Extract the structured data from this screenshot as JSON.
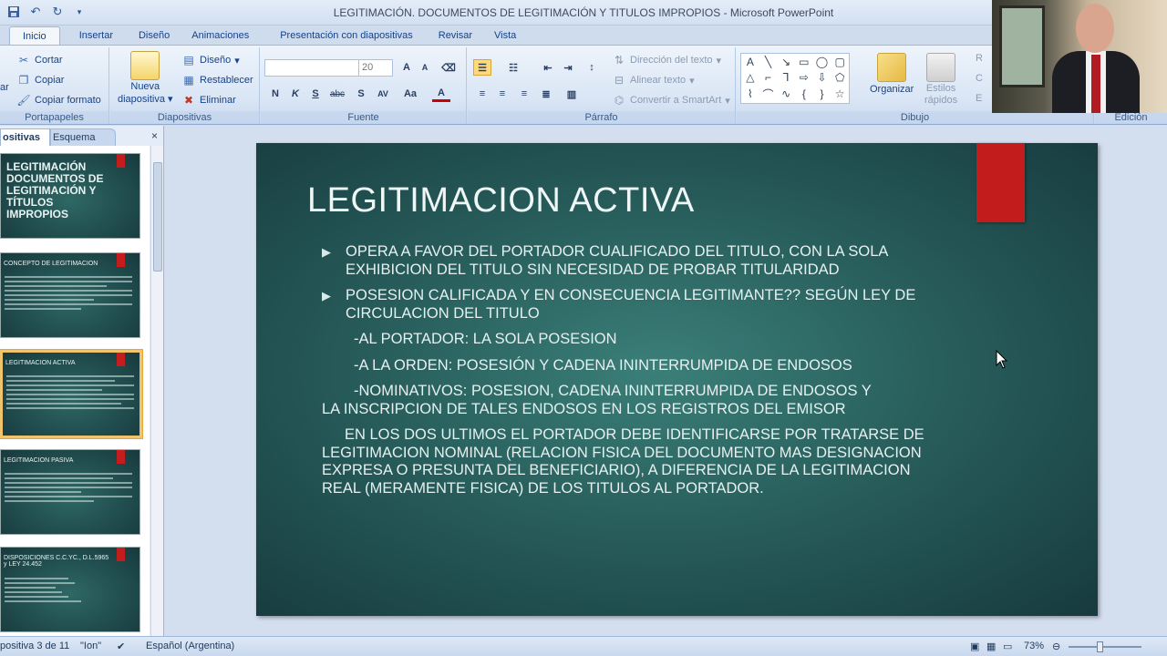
{
  "window": {
    "title": "LEGITIMACIÓN. DOCUMENTOS DE LEGITIMACIÓN Y TITULOS IMPROPIOS - Microsoft PowerPoint"
  },
  "quick_access": [
    "save-icon",
    "undo-icon",
    "redo-icon"
  ],
  "ribbon_tabs": [
    "Inicio",
    "Insertar",
    "Diseño",
    "Animaciones",
    "Presentación con diapositivas",
    "Revisar",
    "Vista"
  ],
  "ribbon": {
    "portapapeles": {
      "label": "Portapapeles",
      "cortar": "Cortar",
      "copiar": "Copiar",
      "copiar_formato": "Copiar formato",
      "pegar_partial": "ar"
    },
    "diapositivas": {
      "label": "Diapositivas",
      "nueva": "Nueva",
      "nueva2": "diapositiva",
      "diseno": "Diseño",
      "restablecer": "Restablecer",
      "eliminar": "Eliminar"
    },
    "fuente": {
      "label": "Fuente",
      "font_name": "",
      "font_size": "20",
      "bold": "N",
      "italic": "K",
      "underline": "S",
      "strike": "abc",
      "shadow": "S",
      "spacing": "AV",
      "case": "Aa",
      "color": "A"
    },
    "parrafo": {
      "label": "Párrafo",
      "direccion": "Dirección del texto",
      "alinear": "Alinear texto",
      "smartart": "Convertir a SmartArt"
    },
    "dibujo": {
      "label": "Dibujo",
      "organizar": "Organizar",
      "estilos": "Estilos",
      "estilos2": "rápidos"
    },
    "edicion": {
      "label": "Edición",
      "partial1": "R",
      "partial2": "C",
      "partial3": "E"
    }
  },
  "panel": {
    "tab_slides": "ositivas",
    "tab_outline": "Esquema",
    "close": "×"
  },
  "thumbnails": [
    {
      "title": "LEGITIMACIÓN DOCUMENTOS DE LEGITIMACIÓN Y TÍTULOS IMPROPIOS"
    },
    {
      "title": "CONCEPTO DE LEGITIMACION"
    },
    {
      "title": "LEGITIMACION ACTIVA"
    },
    {
      "title": "LEGITIMACION PASIVA"
    },
    {
      "title": "DISPOSICIONES C.C.YC., D.L.5965 y LEY 24.452"
    }
  ],
  "slide": {
    "title": "LEGITIMACION ACTIVA",
    "bullets": [
      "OPERA A FAVOR DEL PORTADOR CUALIFICADO DEL TITULO, CON LA SOLA EXHIBICION DEL TITULO SIN NECESIDAD DE PROBAR TITULARIDAD",
      "POSESION CALIFICADA Y EN CONSECUENCIA LEGITIMANTE?? SEGÚN LEY DE CIRCULACION DEL TITULO"
    ],
    "sub1": "-AL PORTADOR: LA SOLA POSESION",
    "sub2": "-A LA ORDEN: POSESIÓN Y CADENA ININTERRUMPIDA DE ENDOSOS",
    "sub3a": "-NOMINATIVOS: POSESION, CADENA ININTERRUMPIDA DE ENDOSOS Y",
    "sub3b": "LA INSCRIPCION DE TALES ENDOSOS EN LOS REGISTROS DEL EMISOR",
    "paragraph": "EN LOS DOS ULTIMOS EL PORTADOR DEBE IDENTIFICARSE POR TRATARSE DE LEGITIMACION NOMINAL (RELACION FISICA DEL DOCUMENTO MAS DESIGNACION EXPRESA O PRESUNTA DEL BENEFICIARIO), A DIFERENCIA DE LA LEGITIMACION REAL (MERAMENTE FISICA) DE LOS TITULOS AL PORTADOR."
  },
  "status": {
    "slide_info": "positiva 3 de 11",
    "theme": "\"Ion\"",
    "language": "Español (Argentina)",
    "zoom": "73%"
  },
  "colors": {
    "accent_red": "#c21c1c",
    "slide_bg": "#285e5c",
    "ribbon_text": "#15428b"
  }
}
